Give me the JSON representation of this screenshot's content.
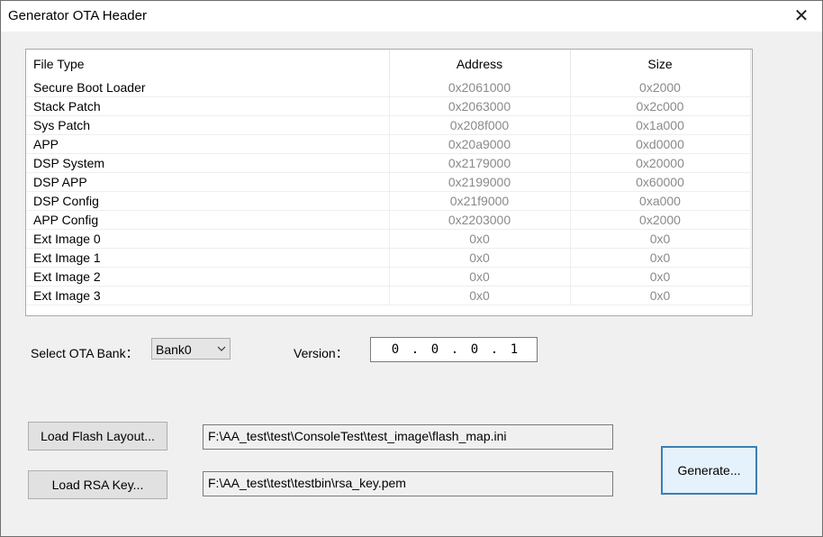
{
  "window": {
    "title": "Generator OTA Header"
  },
  "table": {
    "columns": [
      "File Type",
      "Address",
      "Size"
    ],
    "rows": [
      [
        "Secure Boot Loader",
        "0x2061000",
        "0x2000"
      ],
      [
        "Stack Patch",
        "0x2063000",
        "0x2c000"
      ],
      [
        "Sys Patch",
        "0x208f000",
        "0x1a000"
      ],
      [
        "APP",
        "0x20a9000",
        "0xd0000"
      ],
      [
        "DSP System",
        "0x2179000",
        "0x20000"
      ],
      [
        "DSP APP",
        "0x2199000",
        "0x60000"
      ],
      [
        "DSP Config",
        "0x21f9000",
        "0xa000"
      ],
      [
        "APP Config",
        "0x2203000",
        "0x2000"
      ],
      [
        "Ext Image 0",
        "0x0",
        "0x0"
      ],
      [
        "Ext Image 1",
        "0x0",
        "0x0"
      ],
      [
        "Ext Image 2",
        "0x0",
        "0x0"
      ],
      [
        "Ext Image 3",
        "0x0",
        "0x0"
      ]
    ]
  },
  "ota_bank": {
    "label": "Select OTA Bank：",
    "value": "Bank0"
  },
  "version": {
    "label": "Version：",
    "parts": [
      "0",
      "0",
      "0",
      "1"
    ]
  },
  "load_flash": {
    "button": "Load Flash Layout...",
    "path": "F:\\AA_test\\test\\ConsoleTest\\test_image\\flash_map.ini"
  },
  "load_rsa": {
    "button": "Load RSA Key...",
    "path": "F:\\AA_test\\test\\testbin\\rsa_key.pem"
  },
  "generate": {
    "button": "Generate..."
  }
}
